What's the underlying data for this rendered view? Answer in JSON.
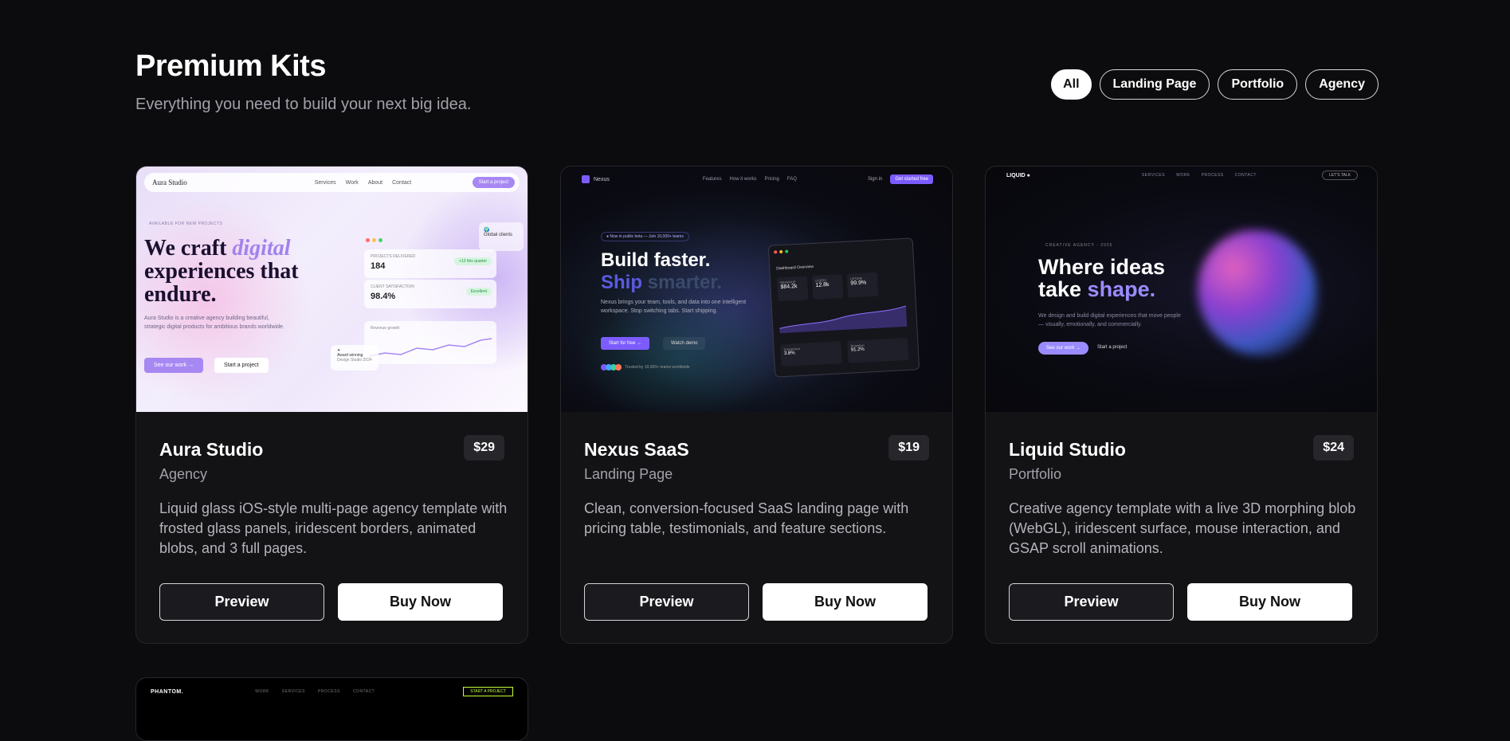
{
  "header": {
    "title": "Premium Kits",
    "subtitle": "Everything you need to build your next big idea."
  },
  "filters": [
    {
      "label": "All",
      "active": true
    },
    {
      "label": "Landing Page",
      "active": false
    },
    {
      "label": "Portfolio",
      "active": false
    },
    {
      "label": "Agency",
      "active": false
    }
  ],
  "cards": [
    {
      "name": "Aura Studio",
      "category": "Agency",
      "price": "$29",
      "description": "Liquid glass iOS-style multi-page agency template with frosted glass panels, iridescent borders, animated blobs, and 3 full pages.",
      "preview_label": "Preview",
      "buy_label": "Buy Now",
      "thumb": {
        "logo": "Aura Studio",
        "links": [
          "Services",
          "Work",
          "About",
          "Contact"
        ],
        "cta": "Start a project",
        "eyebrow": "AVAILABLE FOR NEW PROJECTS",
        "headline_a": "We craft ",
        "headline_em": "digital",
        "headline_b": " experiences that endure.",
        "body": "Aura Studio is a creative agency building beautiful, strategic digital products for ambitious brands worldwide.",
        "btn_primary": "See our work →",
        "btn_secondary": "Start a project",
        "stat1_label": "PROJECTS DELIVERED",
        "stat1_value": "184",
        "stat1_badge": "+12 this quarter",
        "stat2_label": "CLIENT SATISFACTION",
        "stat2_value": "98.4%",
        "stat2_badge": "Excellent",
        "chart_label": "Revenue growth",
        "float_award": "Award winning",
        "float_award_sub": "Design Studio 2024",
        "float_global": "Global clients"
      }
    },
    {
      "name": "Nexus SaaS",
      "category": "Landing Page",
      "price": "$19",
      "description": "Clean, conversion-focused SaaS landing page with pricing table, testimonials, and feature sections.",
      "preview_label": "Preview",
      "buy_label": "Buy Now",
      "thumb": {
        "logo": "Nexus",
        "links": [
          "Features",
          "How it works",
          "Pricing",
          "FAQ"
        ],
        "signin": "Sign in",
        "cta": "Get started free",
        "pill": "● Now in public beta — Join 10,000+ teams",
        "h1": "Build faster.",
        "h2a": "Ship ",
        "h2b": "smarter.",
        "body": "Nexus brings your team, tools, and data into one intelligent workspace. Stop switching tabs. Start shipping.",
        "btn_primary": "Start for free →",
        "btn_secondary": "Watch demo",
        "trusted": "Trusted by 10,000+ teams worldwide",
        "dash_title": "Dashboard Overview",
        "metric1_label": "REVENUE",
        "metric1": "$84.2k",
        "metric2_label": "USERS",
        "metric2": "12.8k",
        "metric3_label": "UPTIME",
        "metric3": "99.9%",
        "small1_label": "Conversion",
        "small1": "3.8%",
        "small2_label": "Retention",
        "small2": "91.2%"
      }
    },
    {
      "name": "Liquid Studio",
      "category": "Portfolio",
      "price": "$24",
      "description": "Creative agency template with a live 3D morphing blob (WebGL), iridescent surface, mouse interaction, and GSAP scroll animations.",
      "preview_label": "Preview",
      "buy_label": "Buy Now",
      "thumb": {
        "logo": "LIQUID ●",
        "links": [
          "SERVICES",
          "WORK",
          "PROCESS",
          "CONTACT"
        ],
        "cta": "LET'S TALK",
        "eyebrow": "CREATIVE AGENCY · 2025",
        "h_a": "Where ideas",
        "h_b": "take ",
        "h_em": "shape.",
        "body": "We design and build digital experiences that move people — visually, emotionally, and commercially.",
        "btn_primary": "See our work →",
        "btn_secondary": "Start a project"
      }
    },
    {
      "thumb": {
        "logo": "PHANTOM.",
        "links": [
          "WORK",
          "SERVICES",
          "PROCESS",
          "CONTACT"
        ],
        "cta": "START A PROJECT"
      }
    }
  ],
  "colors": {
    "background": "#0c0c0e",
    "card": "#131316",
    "accent_purple": "#7c5cff",
    "phantom_accent": "#c8ff3e"
  }
}
